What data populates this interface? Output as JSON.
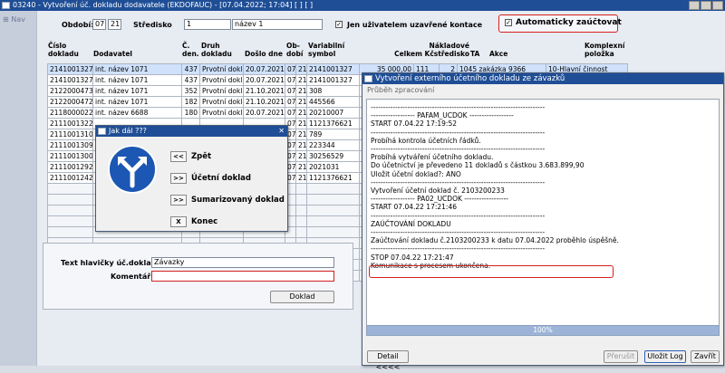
{
  "window": {
    "title": "03240 - Vytvoření úč. dokladu dodavatele (EKDOFAUC) - [07.04.2022; 17:04]  [ ]  [ ]",
    "icon": "app-icon"
  },
  "nav": {
    "label": "Nav"
  },
  "filters": {
    "obdobi_label": "Období:",
    "obdobi_month": "07",
    "obdobi_year": "21",
    "stredisko_label": "Středisko",
    "stredisko_value": "1",
    "stredisko_name": "název 1",
    "uzavrene_label": "Jen uživatelem uzavřené kontace",
    "uzavrene_checked": "✓",
    "auto_label": "Automaticky zaúčtovat",
    "auto_checked": "✓"
  },
  "grid": {
    "columns": {
      "cislo": [
        "Číslo",
        "dokladu"
      ],
      "dodavatel": [
        "",
        "Dodavatel"
      ],
      "c_den": [
        "Č.",
        "den."
      ],
      "druh": [
        "Druh",
        "dokladu"
      ],
      "doslo": [
        "",
        "Došlo dne"
      ],
      "obdobi": [
        "Ob-",
        "dobí"
      ],
      "symbol": [
        "Variabilní",
        "symbol"
      ],
      "naklad": [
        "Nákladové",
        "Celkem Kčstředisko"
      ],
      "ta": [
        "",
        "TA"
      ],
      "akce": [
        "",
        "Akce"
      ],
      "komplex": [
        "Komplexní",
        "položka"
      ]
    },
    "rows": [
      {
        "cislo": "2141001327",
        "dodavatel": "int. název 1071",
        "den": "437",
        "druh": "Prvotní doklad",
        "doslo": "20.07.2021",
        "m": "07",
        "y": "21",
        "symbol": "2141001327",
        "celkem": "35 000,00",
        "stredisko": "111",
        "ta": "2",
        "akce": "1045 zakázka 9366",
        "komplex": "10-Hlavní činnost"
      },
      {
        "cislo": "2141001327",
        "dodavatel": "int. název 1071",
        "den": "437",
        "druh": "Prvotní doklad",
        "doslo": "20.07.2021",
        "m": "07",
        "y": "21",
        "symbol": "2141001327"
      },
      {
        "cislo": "2122000473",
        "dodavatel": "int. název 1071",
        "den": "352",
        "druh": "Prvotní doklad",
        "doslo": "21.10.2021",
        "m": "07",
        "y": "21",
        "symbol": "308"
      },
      {
        "cislo": "2122000472",
        "dodavatel": "int. název 1071",
        "den": "182",
        "druh": "Prvotní doklad",
        "doslo": "21.10.2021",
        "m": "07",
        "y": "21",
        "symbol": "445566"
      },
      {
        "cislo": "2118000022",
        "dodavatel": "int. název 6688",
        "den": "180",
        "druh": "Prvotní doklad",
        "doslo": "20.07.2021",
        "m": "07",
        "y": "21",
        "symbol": "20210007"
      },
      {
        "cislo": "2111001322",
        "dodavatel": "",
        "den": "",
        "druh": "",
        "doslo": "",
        "m": "07",
        "y": "21",
        "symbol": "1121376621"
      },
      {
        "cislo": "2111001310",
        "dodavatel": "",
        "den": "",
        "druh": "",
        "doslo": "",
        "m": "07",
        "y": "21",
        "symbol": "789"
      },
      {
        "cislo": "2111001309",
        "dodavatel": "",
        "den": "",
        "druh": "",
        "doslo": "",
        "m": "07",
        "y": "21",
        "symbol": "223344"
      },
      {
        "cislo": "2111001300",
        "dodavatel": "",
        "den": "",
        "druh": "",
        "doslo": "",
        "m": "07",
        "y": "21",
        "symbol": "30256529"
      },
      {
        "cislo": "2111001292",
        "dodavatel": "",
        "den": "",
        "druh": "",
        "doslo": "",
        "m": "07",
        "y": "21",
        "symbol": "2021031"
      },
      {
        "cislo": "2111001242",
        "dodavatel": "",
        "den": "",
        "druh": "",
        "doslo": "",
        "m": "07",
        "y": "21",
        "symbol": "1121376621"
      }
    ]
  },
  "jak_dal": {
    "title": "Jak dál ???",
    "items": [
      {
        "key": "<<",
        "label": "Zpět"
      },
      {
        "key": ">>",
        "label": "Účetní doklad"
      },
      {
        "key": ">>",
        "label": "Sumarizovaný doklad"
      },
      {
        "key": "X",
        "label": "Konec"
      }
    ]
  },
  "form": {
    "text_label": "Text hlavičky úč.dokladu",
    "text_value": "Závazky",
    "komentar_label": "Komentář",
    "komentar_value": "",
    "doklad_button": "Doklad"
  },
  "log_dialog": {
    "title": "Vytvoření externího účetního dokladu ze závazků",
    "subtitle": "Průběh zpracování",
    "lines": [
      "-----------------------------------------------------------------------",
      "------------------ PAFAM_UCDOK ------------------",
      "START 07.04.22 17:19:52",
      "-----------------------------------------------------------------------",
      "Probíhá kontrola účetních řádků.",
      "-----------------------------------------------------------------------",
      "Probíhá vytváření účetního dokladu.",
      "Do účetnictví  je převedeno 11 dokladů s částkou        3.683.899,90",
      " Uložit účetní doklad?: ANO",
      "-----------------------------------------------------------------------",
      "Vytvoření účetní doklad č. 2103200233",
      "------------------ PA02_UCDOK ------------------",
      "START 07.04.22 17:21:46",
      "-----------------------------------------------------------------------",
      "ZAÚČTOVÁNÍ DOKLADU",
      "-----------------------------------------------------------------------",
      "Zaúčtování dokladu č.2103200233 k datu 07.04.2022 proběhlo úspěšně.",
      "-----------------------------------------------------------------------",
      "STOP 07.04.22 17:21:47",
      "Komunikace s procesem ukončena."
    ],
    "progress_label": "100%",
    "progress": 1.0,
    "detail_button": "Detail <<<<",
    "prerusit_button": "Přerušit",
    "ulozit_button": "Uložit Log",
    "zavrit_button": "Zavřít"
  }
}
